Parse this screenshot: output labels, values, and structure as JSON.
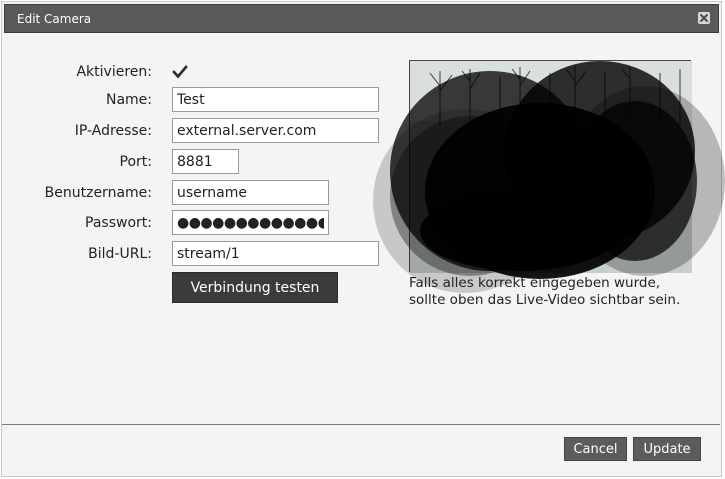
{
  "dialog": {
    "title": "Edit Camera",
    "close_icon": "close-icon"
  },
  "form": {
    "activate": {
      "label": "Aktivieren:",
      "checked": true
    },
    "name": {
      "label": "Name:",
      "value": "Test"
    },
    "ip": {
      "label": "IP-Adresse:",
      "value": "external.server.com"
    },
    "port": {
      "label": "Port:",
      "value": "8881"
    },
    "username": {
      "label": "Benutzername:",
      "value": "username"
    },
    "password": {
      "label": "Passwort:",
      "value": "●●●●●●●●●●●●●●"
    },
    "image_url": {
      "label": "Bild-URL:",
      "value": "stream/1"
    },
    "test_button": "Verbindung testen"
  },
  "preview": {
    "hint_line1": "Falls alles korrekt eingegeben wurde,",
    "hint_line2": "sollte oben das Live-Video sichtbar sein."
  },
  "footer": {
    "cancel": "Cancel",
    "update": "Update"
  },
  "colors": {
    "titlebar": "#5a5a5a",
    "dialog_bg": "#f4f4f4",
    "primary_button": "#3b3b3b",
    "footer_button": "#5c5c5c"
  }
}
